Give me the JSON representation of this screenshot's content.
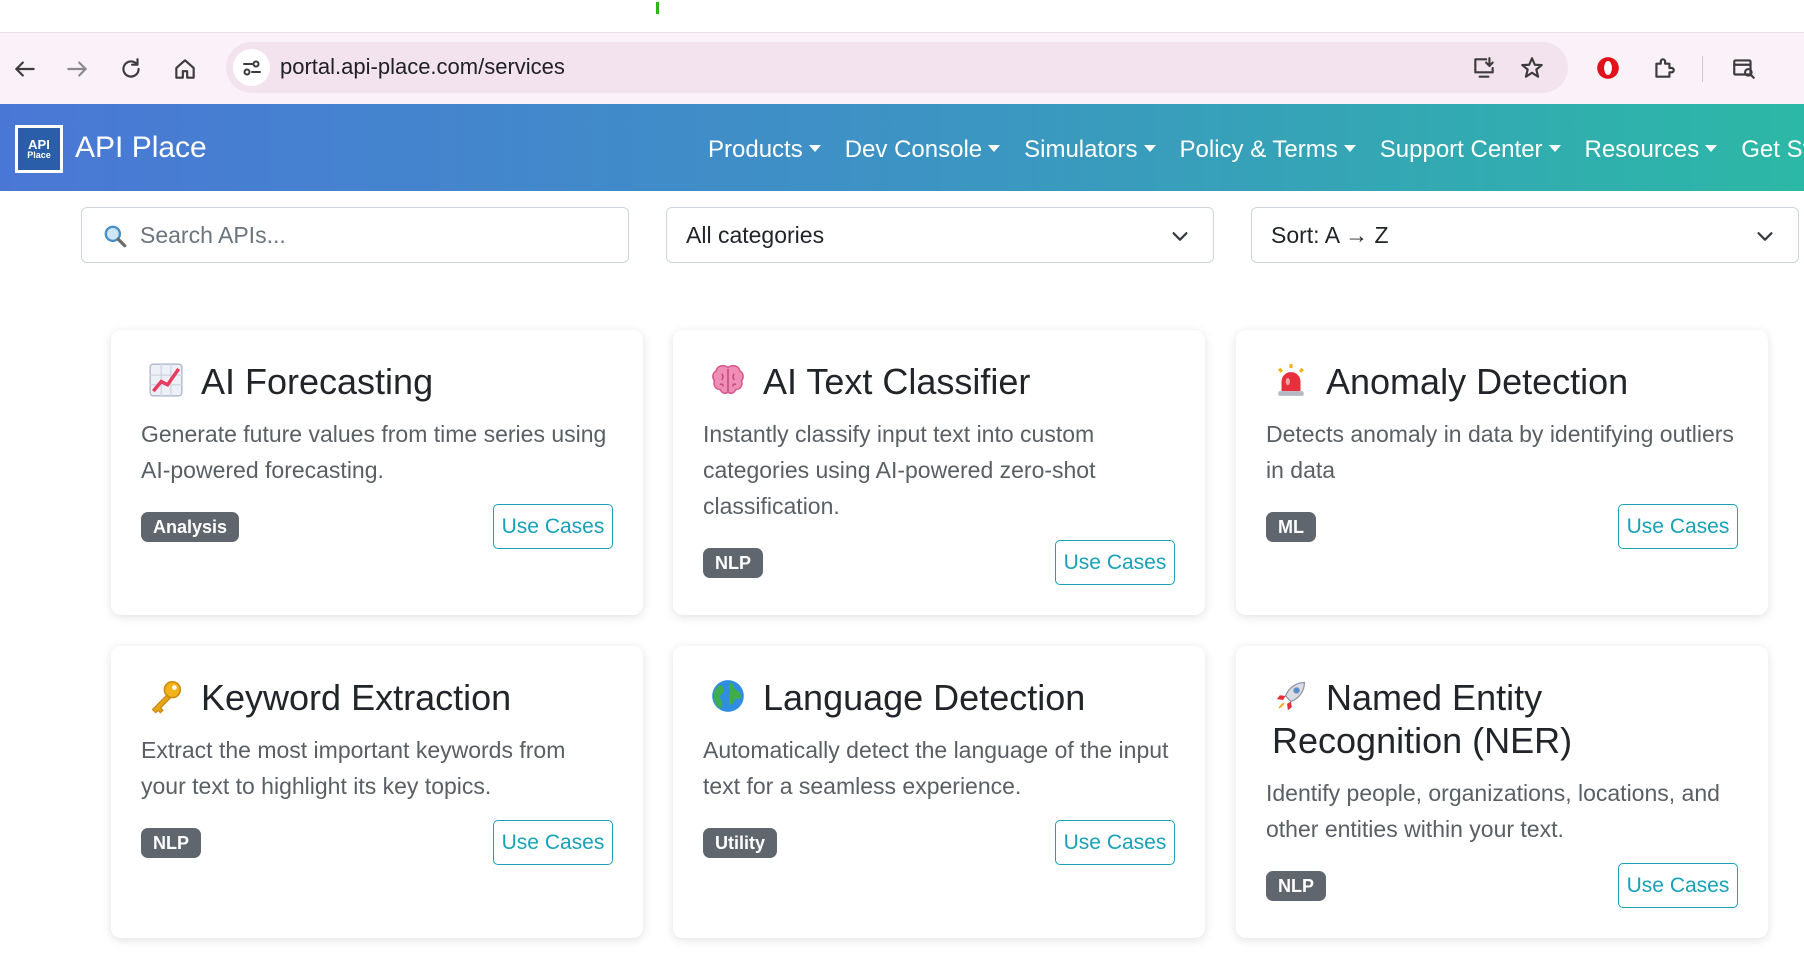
{
  "browser": {
    "url": "portal.api-place.com/services"
  },
  "navbar": {
    "brand_logo_line1": "API",
    "brand_logo_line2": "Place",
    "brand_name": "API Place",
    "items": [
      {
        "label": "Products"
      },
      {
        "label": "Dev Console"
      },
      {
        "label": "Simulators"
      },
      {
        "label": "Policy & Terms"
      },
      {
        "label": "Support Center"
      },
      {
        "label": "Resources"
      },
      {
        "label": "Get Sta"
      }
    ]
  },
  "filters": {
    "search_placeholder": "Search APIs...",
    "category_selected": "All categories",
    "sort_selected": "Sort: A → Z"
  },
  "cards": [
    {
      "icon": "chart-increasing-icon",
      "title": "AI Forecasting",
      "description": "Generate future values from time series using AI-powered forecasting.",
      "badge": "Analysis",
      "button": "Use Cases"
    },
    {
      "icon": "brain-icon",
      "title": "AI Text Classifier",
      "description": "Instantly classify input text into custom categories using AI-powered zero-shot classification.",
      "badge": "NLP",
      "button": "Use Cases"
    },
    {
      "icon": "alarm-light-icon",
      "title": "Anomaly Detection",
      "description": "Detects anomaly in data by identifying outliers in data",
      "badge": "ML",
      "button": "Use Cases"
    },
    {
      "icon": "key-icon",
      "title": "Keyword Extraction",
      "description": "Extract the most important keywords from your text to highlight its key topics.",
      "badge": "NLP",
      "button": "Use Cases"
    },
    {
      "icon": "globe-icon",
      "title": "Language Detection",
      "description": "Automatically detect the language of the input text for a seamless experience.",
      "badge": "Utility",
      "button": "Use Cases"
    },
    {
      "icon": "rocket-icon",
      "title": "Named Entity Recognition (NER)",
      "description": "Identify people, organizations, locations, and other entities within your text.",
      "badge": "NLP",
      "button": "Use Cases"
    }
  ],
  "colors": {
    "navbar_gradient_start": "#4a77d6",
    "navbar_gradient_end": "#2cb8a6",
    "badge_bg": "#5f666d",
    "button_accent": "#17a2b8"
  }
}
